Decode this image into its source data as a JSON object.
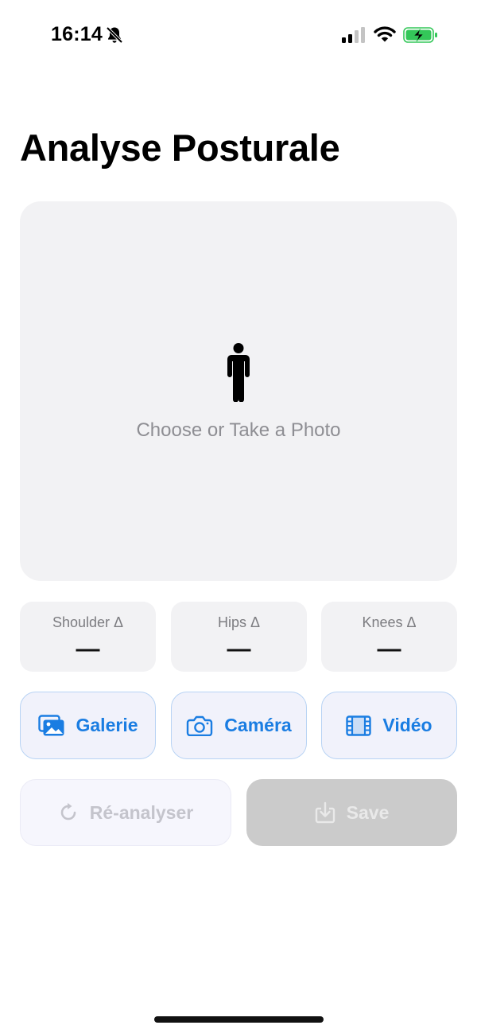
{
  "status_bar": {
    "time": "16:14",
    "icons": [
      "bell-slash-icon",
      "cellular-signal-icon",
      "wifi-icon",
      "battery-charging-icon"
    ],
    "battery_color": "#34c759"
  },
  "header": {
    "title": "Analyse Posturale"
  },
  "photo_area": {
    "icon": "person-standing-icon",
    "prompt": "Choose or Take a Photo"
  },
  "metrics": [
    {
      "label": "Shoulder Δ",
      "value": "—"
    },
    {
      "label": "Hips Δ",
      "value": "—"
    },
    {
      "label": "Knees Δ",
      "value": "—"
    }
  ],
  "sources": [
    {
      "label": "Galerie",
      "icon": "photo-stack-icon"
    },
    {
      "label": "Caméra",
      "icon": "camera-icon"
    },
    {
      "label": "Vidéo",
      "icon": "film-icon"
    }
  ],
  "actions": {
    "reanalyze_label": "Ré-analyser",
    "reanalyze_icon": "refresh-icon",
    "save_label": "Save",
    "save_icon": "download-icon"
  },
  "colors": {
    "accent": "#1a7de2",
    "card_bg": "#f2f2f4",
    "disabled_bg": "#cbcbcb"
  }
}
